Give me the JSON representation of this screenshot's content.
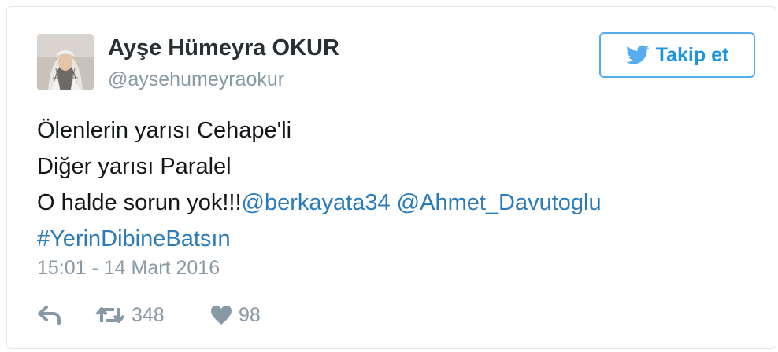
{
  "tweet": {
    "author_name": "Ayşe Hümeyra OKUR",
    "author_handle": "@aysehumeyraokur",
    "follow_label": "Takip et",
    "lines": {
      "line1": "Ölenlerin yarısı Cehape'li",
      "line2": "Diğer yarısı Paralel",
      "line3_text": "O halde sorun yok!!!",
      "mention1": "@berkayata34",
      "mention2": "@Ahmet_Davutoglu",
      "hashtag": "#YerinDibineBatsın"
    },
    "timestamp": "15:01 - 14 Mart 2016",
    "retweets": "348",
    "likes": "98"
  },
  "colors": {
    "link": "#2b7bb9",
    "muted": "#8899a6",
    "twitter_blue": "#55acee"
  },
  "icons": [
    "twitter-bird-icon",
    "reply-icon",
    "retweet-icon",
    "heart-icon"
  ]
}
